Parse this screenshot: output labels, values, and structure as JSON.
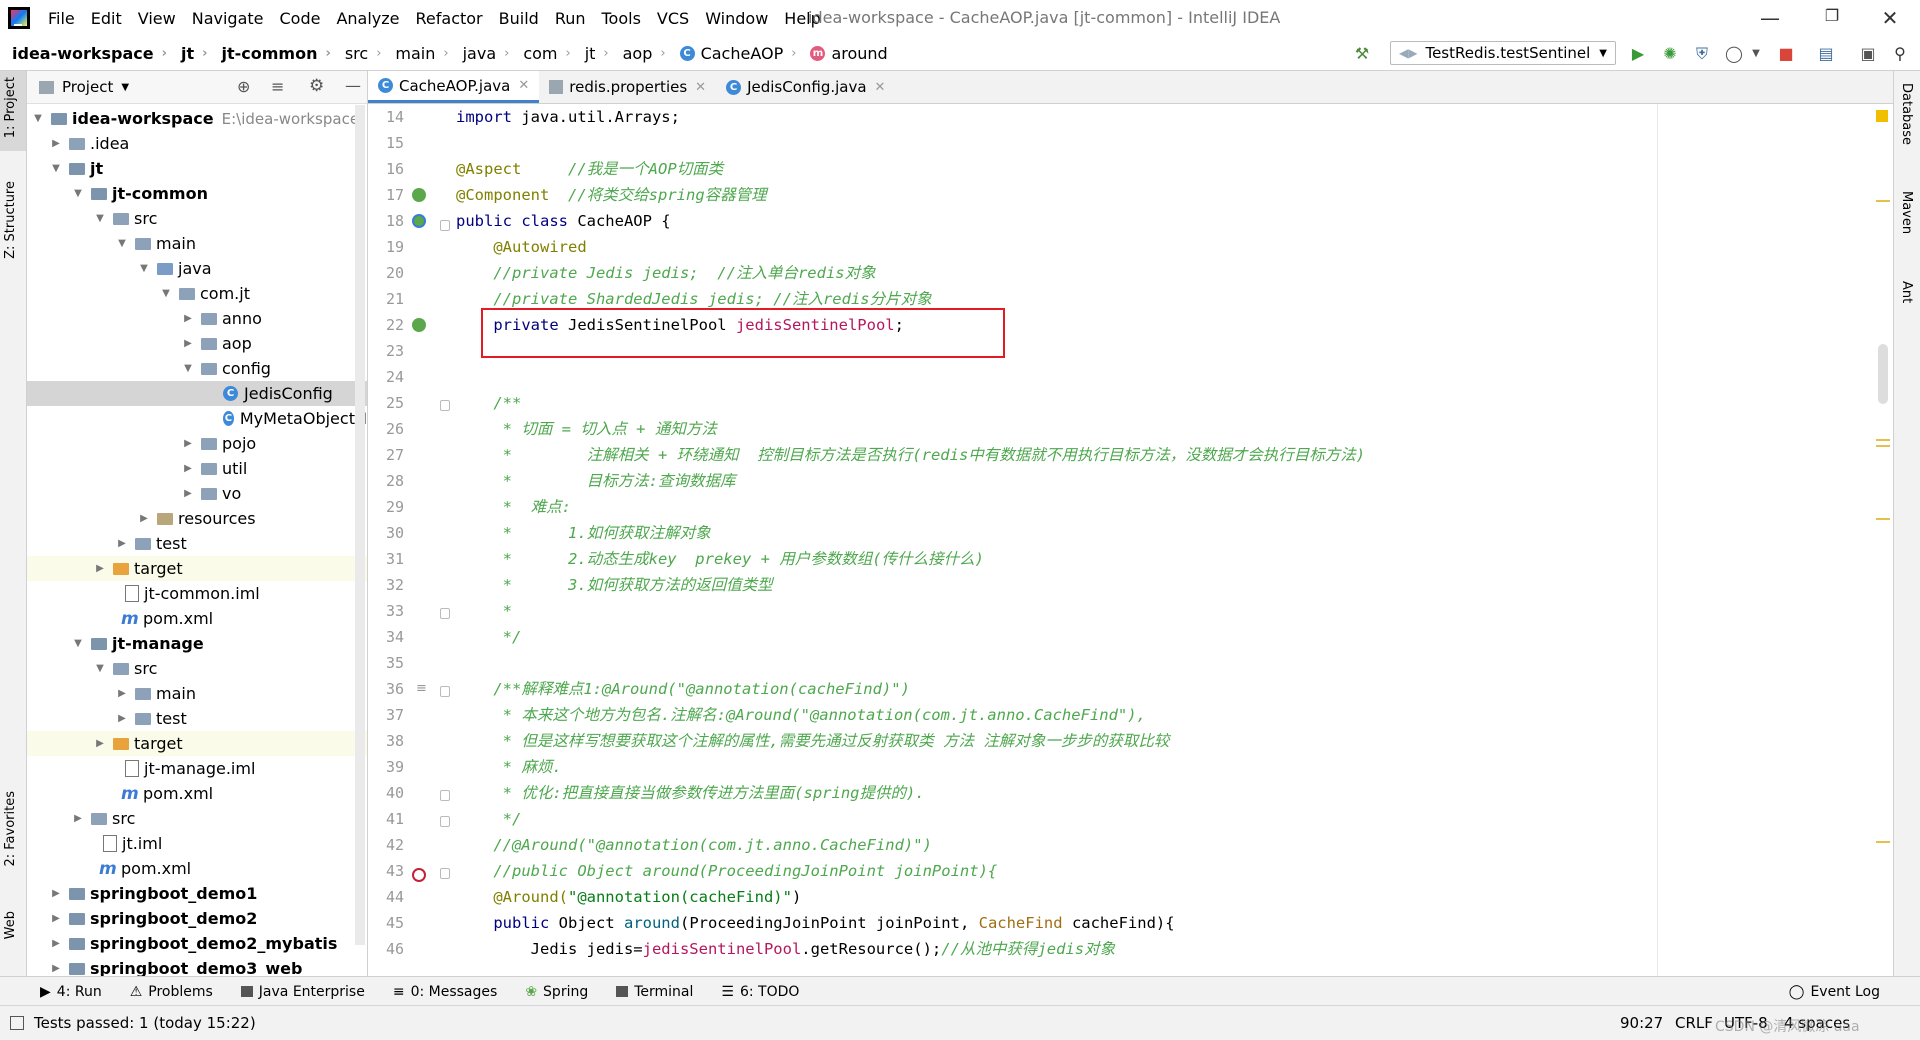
{
  "menubar": {
    "items": [
      "File",
      "Edit",
      "View",
      "Navigate",
      "Code",
      "Analyze",
      "Refactor",
      "Build",
      "Run",
      "Tools",
      "VCS",
      "Window",
      "Help"
    ],
    "title": "idea-workspace - CacheAOP.java [jt-common] - IntelliJ IDEA"
  },
  "navbar": {
    "crumbs": [
      "idea-workspace",
      "jt",
      "jt-common",
      "src",
      "main",
      "java",
      "com",
      "jt",
      "aop",
      "CacheAOP",
      "around"
    ],
    "run_config": "TestRedis.testSentinel"
  },
  "left_stripe": {
    "project": "1: Project",
    "structure": "Z: Structure",
    "favorites": "2: Favorites",
    "web": "Web"
  },
  "right_stripe": {
    "database": "Database",
    "maven": "Maven",
    "ant": "Ant"
  },
  "project_panel": {
    "title": "Project",
    "tree": [
      {
        "label": "idea-workspace",
        "hint": "E:\\idea-workspace"
      },
      {
        "label": ".idea"
      },
      {
        "label": "jt"
      },
      {
        "label": "jt-common"
      },
      {
        "label": "src"
      },
      {
        "label": "main"
      },
      {
        "label": "java"
      },
      {
        "label": "com.jt"
      },
      {
        "label": "anno"
      },
      {
        "label": "aop"
      },
      {
        "label": "config"
      },
      {
        "label": "JedisConfig"
      },
      {
        "label": "MyMetaObjectH"
      },
      {
        "label": "pojo"
      },
      {
        "label": "util"
      },
      {
        "label": "vo"
      },
      {
        "label": "resources"
      },
      {
        "label": "test"
      },
      {
        "label": "target"
      },
      {
        "label": "jt-common.iml"
      },
      {
        "label": "pom.xml"
      },
      {
        "label": "jt-manage"
      },
      {
        "label": "src"
      },
      {
        "label": "main"
      },
      {
        "label": "test"
      },
      {
        "label": "target"
      },
      {
        "label": "jt-manage.iml"
      },
      {
        "label": "pom.xml"
      },
      {
        "label": "src"
      },
      {
        "label": "jt.iml"
      },
      {
        "label": "pom.xml"
      },
      {
        "label": "springboot_demo1"
      },
      {
        "label": "springboot_demo2"
      },
      {
        "label": "springboot_demo2_mybatis"
      },
      {
        "label": "springboot_demo3_web"
      }
    ]
  },
  "editor_tabs": [
    "CacheAOP.java",
    "redis.properties",
    "JedisConfig.java"
  ],
  "line_numbers": [
    "14",
    "15",
    "16",
    "17",
    "18",
    "19",
    "20",
    "21",
    "22",
    "23",
    "24",
    "25",
    "26",
    "27",
    "28",
    "29",
    "30",
    "31",
    "32",
    "33",
    "34",
    "35",
    "36",
    "37",
    "38",
    "39",
    "40",
    "41",
    "42",
    "43",
    "44",
    "45",
    "46"
  ],
  "code": {
    "l14a": "import",
    "l14b": " java.util.Arrays;",
    "l16a": "@Aspect",
    "l16b": "     //我是一个AOP切面类",
    "l17a": "@Component",
    "l17b": "  //将类交给spring容器管理",
    "l18a": "public class",
    "l18b": " CacheAOP {",
    "l19": "    @Autowired",
    "l20": "    //private Jedis jedis;  //注入单台redis对象",
    "l21": "    //private ShardedJedis jedis; //注入redis分片对象",
    "l22a": "    private",
    "l22b": " JedisSentinelPool ",
    "l22c": "jedisSentinelPool",
    "l22d": ";",
    "l25": "    /**",
    "l26": "     * 切面 = 切入点 + 通知方法",
    "l27": "     *        注解相关 + 环绕通知  控制目标方法是否执行(redis中有数据就不用执行目标方法，没数据才会执行目标方法)",
    "l28": "     *        目标方法:查询数据库",
    "l29": "     *  难点:",
    "l30": "     *      1.如何获取注解对象",
    "l31": "     *      2.动态生成key  prekey + 用户参数数组(传什么接什么)",
    "l32": "     *      3.如何获取方法的返回值类型",
    "l33": "     *",
    "l34": "     */",
    "l36": "    /**解释难点1:@Around(\"@annotation(cacheFind)\")",
    "l37": "     * 本来这个地方为包名.注解名:@Around(\"@annotation(com.jt.anno.CacheFind\"),",
    "l38": "     * 但是这样写想要获取这个注解的属性,需要先通过反射获取类 方法 注解对象一步步的获取比较",
    "l39": "     * 麻烦.",
    "l40": "     * 优化:把直接直接当做参数传进方法里面(spring提供的).",
    "l41": "     */",
    "l42": "    //@Around(\"@annotation(com.jt.anno.CacheFind)\")",
    "l43": "    //public Object around(ProceedingJoinPoint joinPoint){",
    "l44a": "    @Around(",
    "l44b": "\"@annotation(cacheFind)\"",
    "l44c": ")",
    "l45a": "    public",
    "l45b": " Object ",
    "l45c": "around",
    "l45d": "(ProceedingJoinPoint joinPoint, ",
    "l45e": "CacheFind",
    "l45f": " cacheFind){",
    "l46a": "        Jedis jedis=",
    "l46b": "jedisSentinelPool",
    "l46c": ".getResource();",
    "l46d": "//从池中获得jedis对象"
  },
  "bottom_tools": [
    "4: Run",
    "Problems",
    "Java Enterprise",
    "0: Messages",
    "Spring",
    "Terminal",
    "6: TODO",
    "Event Log"
  ],
  "status": {
    "left": "Tests passed: 1 (today 15:22)",
    "position": "90:27",
    "line_sep": "CRLF",
    "encoding": "UTF-8",
    "indent": "4 spaces",
    "watermark": "CSDN @清风微凉 aaa"
  }
}
